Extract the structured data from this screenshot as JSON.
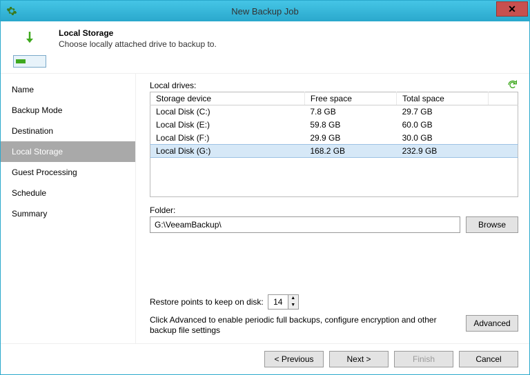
{
  "window": {
    "title": "New Backup Job"
  },
  "header": {
    "title": "Local Storage",
    "subtitle": "Choose locally attached drive to backup to."
  },
  "sidebar": [
    "Name",
    "Backup Mode",
    "Destination",
    "Local Storage",
    "Guest Processing",
    "Schedule",
    "Summary"
  ],
  "main": {
    "drives_label": "Local drives:",
    "columns": [
      "Storage device",
      "Free space",
      "Total space"
    ],
    "drives": [
      {
        "name": "Local Disk (C:)",
        "free": "7.8 GB",
        "total": "29.7 GB"
      },
      {
        "name": "Local Disk (E:)",
        "free": "59.8 GB",
        "total": "60.0 GB"
      },
      {
        "name": "Local Disk (F:)",
        "free": "29.9 GB",
        "total": "30.0 GB"
      },
      {
        "name": "Local Disk (G:)",
        "free": "168.2 GB",
        "total": "232.9 GB"
      }
    ],
    "folder_label": "Folder:",
    "folder_value": "G:\\VeeamBackup\\",
    "restore_label": "Restore points to keep on disk:",
    "restore_points": "14",
    "advanced_hint": "Click Advanced to enable periodic full backups, configure encryption and other backup file settings"
  },
  "buttons": {
    "browse": "Browse",
    "advanced": "Advanced",
    "previous": "< Previous",
    "next": "Next >",
    "finish": "Finish",
    "cancel": "Cancel"
  }
}
